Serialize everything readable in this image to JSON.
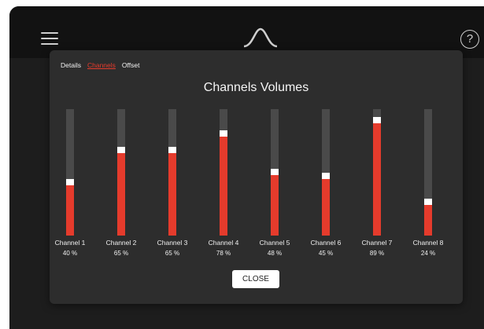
{
  "header": {
    "menu_icon": "hamburger-menu-icon",
    "logo_icon": "wave-peak-logo",
    "help_label": "?"
  },
  "tabs": [
    {
      "label": "Details",
      "active": false
    },
    {
      "label": "Channels",
      "active": true
    },
    {
      "label": "Offset",
      "active": false
    }
  ],
  "title": "Channels Volumes",
  "channels": [
    {
      "name": "Channel 1",
      "value_label": "40 %",
      "level": 40
    },
    {
      "name": "Channel 2",
      "value_label": "65 %",
      "level": 65
    },
    {
      "name": "Channel 3",
      "value_label": "65 %",
      "level": 65
    },
    {
      "name": "Channel 4",
      "value_label": "78 %",
      "level": 78
    },
    {
      "name": "Channel 5",
      "value_label": "48 %",
      "level": 48
    },
    {
      "name": "Channel 6",
      "value_label": "45 %",
      "level": 45
    },
    {
      "name": "Channel 7",
      "value_label": "89 %",
      "level": 89
    },
    {
      "name": "Channel 8",
      "value_label": "24 %",
      "level": 24
    }
  ],
  "close_label": "CLOSE",
  "colors": {
    "accent": "#e53b2c",
    "track": "#4a4a4a",
    "panel": "#2d2d2d",
    "background": "#1d1d1d"
  }
}
